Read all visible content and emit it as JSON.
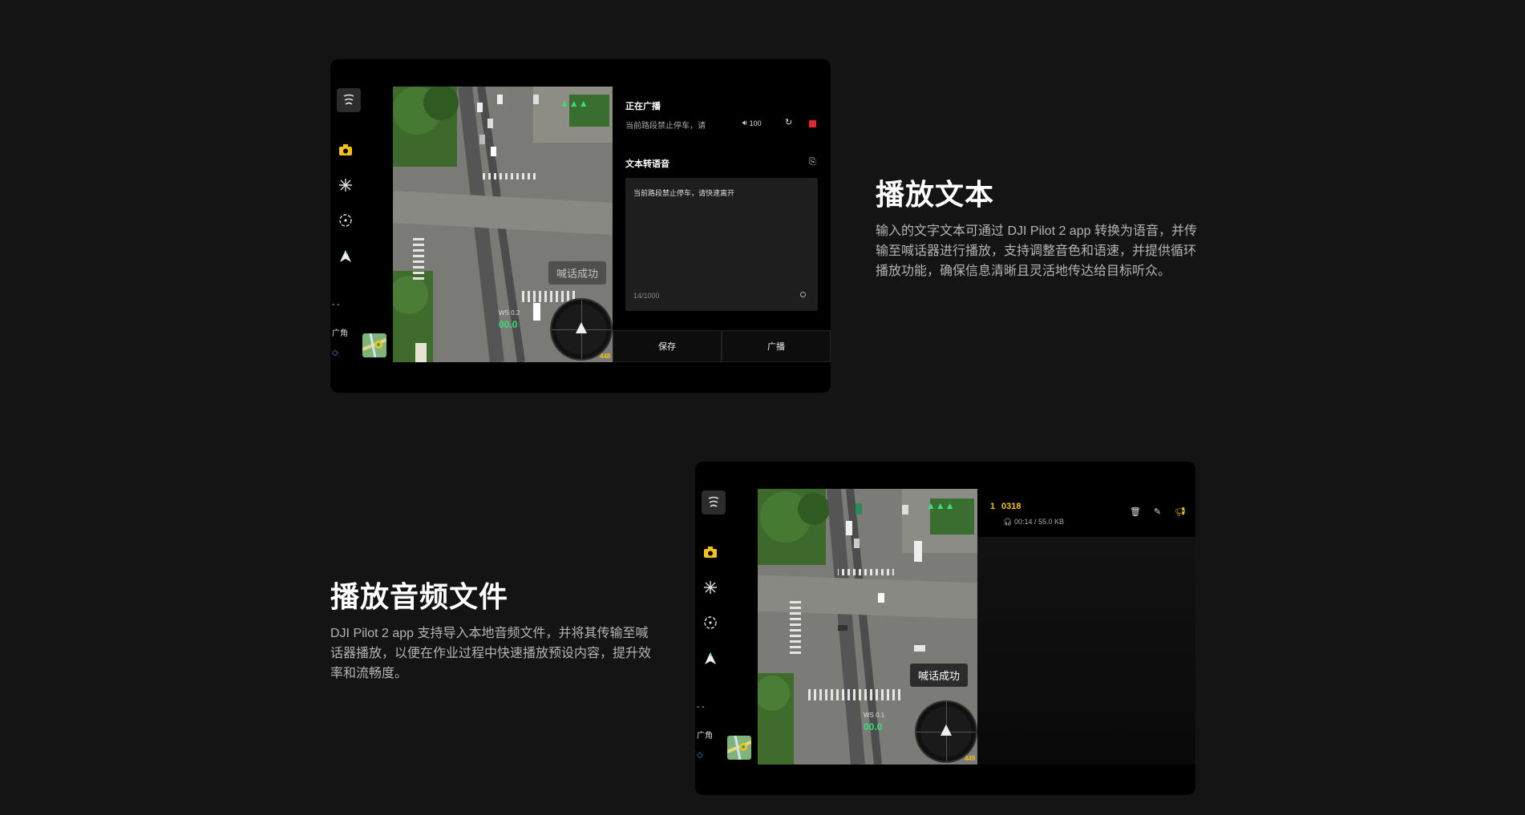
{
  "section1": {
    "title": "播放文本",
    "description": "输入的文字文本可通过 DJI Pilot 2 app 转换为语音，并传输至喊话器进行播放，支持调整音色和语速，并提供循环播放功能，确保信息清晰且灵活地传达给目标听众。"
  },
  "section2": {
    "title": "播放音频文件",
    "description": "DJI Pilot 2 app 支持导入本地音频文件，并将其传输至喊话器播放，以便在作业过程中快速播放预设内容，提升效率和流畅度。"
  },
  "sidebar": {
    "label_dashes": "- -",
    "label_wide": "广角",
    "label_mode": "◇"
  },
  "device1": {
    "broadcasting_title": "正在广播",
    "broadcasting_text": "当前路段禁止停车，请",
    "volume": "100",
    "tts_title": "文本转语音",
    "tts_text": "当前路段禁止停车，请快速离开",
    "char_count": "14/1000",
    "save_label": "保存",
    "broadcast_label": "广播",
    "toast": "喊话成功",
    "hud_alt_label": "WS 0.2",
    "hud_speed": "00.0",
    "hud_dist": "448"
  },
  "device2": {
    "track_index": "1",
    "track_name": "0318",
    "track_meta": "00:14 / 55.0 KB",
    "toast": "喊话成功",
    "hud_alt_label": "WS 0.1",
    "hud_speed": "00.0",
    "hud_dist": "449"
  },
  "colors": {
    "background": "#141414",
    "accent_yellow": "#f2c21b",
    "record_red": "#e5282d",
    "hud_green": "#37e07a"
  }
}
